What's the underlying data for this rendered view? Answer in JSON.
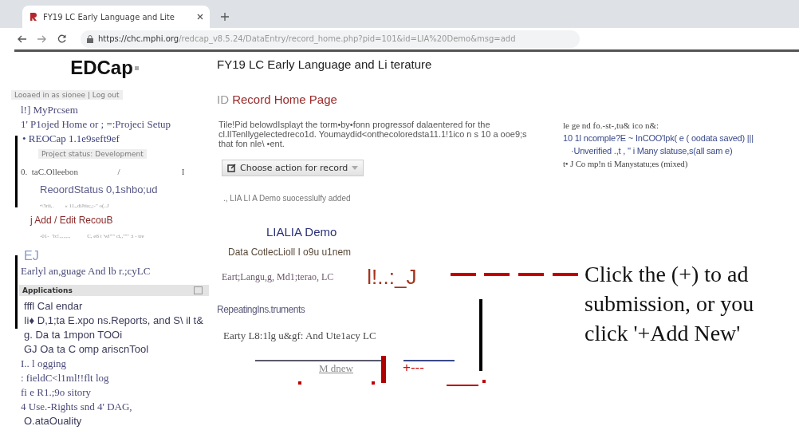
{
  "browser": {
    "tab_title": "FY19 LC Early Language and Lite",
    "url_host": "https://chc.mphi.org",
    "url_path": "/redcap_v8.5.24/DataEntry/record_home.php?pid=101&id=LIA%20Demo&msg=add"
  },
  "sidebar": {
    "logo": "EDCap",
    "lines": [
      {
        "kind": "login",
        "text": "Looaed in as sionee | Log out"
      },
      {
        "kind": "link",
        "text": "l!] MyPrcsem"
      },
      {
        "kind": "link",
        "text": "1' P1ojed Home or ; =:Projeci Setup"
      },
      {
        "kind": "sub",
        "text": "• REOCap 1.1e9seft9ef"
      },
      {
        "kind": "badge",
        "text": "Project status: Development"
      },
      {
        "kind": "plain",
        "text": "0.  taC.Olleebon                  /                            I"
      },
      {
        "kind": "sans-sub",
        "text": "ReoordStatus 0,1shbo;ud"
      },
      {
        "kind": "tiny",
        "text": "•\\'lrii,.        « 11,,diJtia;,;-\" o(..J"
      },
      {
        "kind": "add",
        "text": "j Add / Edit RecouB"
      },
      {
        "kind": "tiny",
        "text": "-01-  'b:!.,.,.,.,            C, e6 t 'wl''''' ci,,'''''' :i - tre"
      },
      {
        "kind": "heading",
        "text": "EJ"
      },
      {
        "kind": "link",
        "text": "Earlyl an,guage And lb r.;cyLC"
      },
      {
        "kind": "section",
        "text": "Applications"
      },
      {
        "kind": "app",
        "text": "fffl Cal endar"
      },
      {
        "kind": "app",
        "text": "Ii♦ D,1;ta E.xpo ns.Reports, and S\\ il t&"
      },
      {
        "kind": "app",
        "text": "g. Da ta 1mpon TOOi"
      },
      {
        "kind": "app",
        "text": "GJ Oa ta C omp ariscnTool"
      },
      {
        "kind": "link",
        "text": "I.. l ogging"
      },
      {
        "kind": "link",
        "text": ": fieldC<l1ml!!flt log"
      },
      {
        "kind": "link",
        "text": "fi e R1.;9o sitory"
      },
      {
        "kind": "link",
        "text": "4 Use.-Rights snd 4' DAG,"
      },
      {
        "kind": "app",
        "text": "O.ataOuality"
      }
    ]
  },
  "main": {
    "items": [
      {
        "kind": "title",
        "text": "FY19 LC Early Language and Li terature"
      },
      {
        "kind": "page-heading",
        "prefix": "ID",
        "text": "Record Home Page"
      },
      {
        "kind": "paragraph",
        "text": "Tile!Pid belowdIsplayt the torm•by•fonn progressof dalaentered for the cl.lITenllygelectedreco1d. Youmaydid<onthecoloredsta11.1!1ico n s 10 a ooe9;s that fon nle\\ •ent."
      },
      {
        "kind": "action-button",
        "text": "Choose action for record"
      },
      {
        "kind": "message",
        "text": "., LIA LI A Demo suocesslulfy added"
      },
      {
        "kind": "record-title",
        "text": "LIALIA Demo"
      },
      {
        "kind": "subheading",
        "text": "Data CotlecLioll I o9u u1nem"
      },
      {
        "kind": "form-row",
        "text": "Eart;Langu,g, Md1;terao, LC",
        "mark": "l!..:_J"
      },
      {
        "kind": "repeat-heading",
        "text": "RepeatingIns.truments"
      },
      {
        "kind": "repeat-row",
        "text": "Earty L8:1lg u&gf: And Ute1acy LC"
      },
      {
        "kind": "add-row",
        "text": "M dnew",
        "mark": "+---"
      }
    ]
  },
  "legend": {
    "title": "le ge nd fo.-st-,tu& ico n&:",
    "rows": [
      "10 1l ncomple?E ~ InCOO'lpk( e ( oodata saved) |||",
      "·Unverified .,t , '' i Many slatuse,s(all sam e)",
      "t• J Co mp!n ti Manystatu;es (mixed)"
    ]
  },
  "callout": {
    "lines": [
      "Click the (+) to ad",
      "submission, or you",
      "click '+Add New'"
    ]
  }
}
